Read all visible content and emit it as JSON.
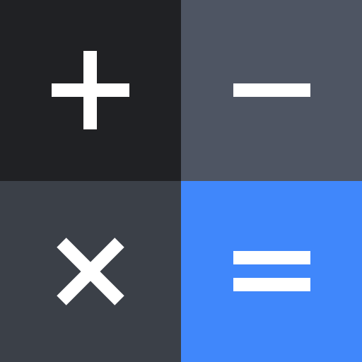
{
  "app_icon": {
    "tiles": [
      {
        "id": "plus",
        "icon": "plus-icon",
        "color": "#202124"
      },
      {
        "id": "minus",
        "icon": "minus-icon",
        "color": "#4e5563"
      },
      {
        "id": "times",
        "icon": "multiply-icon",
        "color": "#3b4048"
      },
      {
        "id": "equals",
        "icon": "equals-icon",
        "color": "#4087fb"
      }
    ],
    "glyph_color": "#ffffff"
  }
}
